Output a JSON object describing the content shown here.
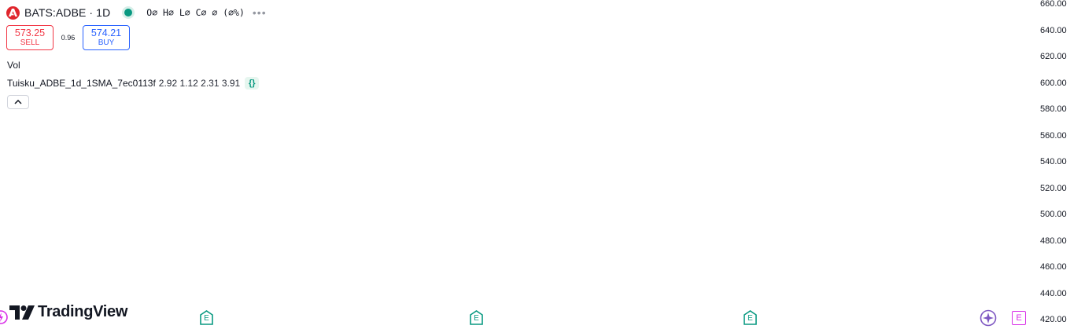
{
  "symbol": {
    "title": "BATS:ADBE · 1D",
    "logo_icon": "adobe-logo-icon",
    "ohlc": "O∅ H∅ L∅ C∅ ∅ (∅%)"
  },
  "trade": {
    "sell_price": "573.25",
    "sell_label": "SELL",
    "spread": "0.96",
    "buy_price": "574.21",
    "buy_label": "BUY"
  },
  "legend": {
    "volume_label": "Vol",
    "indicator_name": "Tuisku_ADBE_1d_1SMA_7ec0113f",
    "indicator_values": "2.92 1.12 2.31 3.91",
    "source_code_icon": "{}"
  },
  "price_scale": {
    "ticks": [
      "660.00",
      "640.00",
      "620.00",
      "600.00",
      "580.00",
      "560.00",
      "540.00",
      "520.00",
      "500.00",
      "480.00",
      "460.00",
      "440.00",
      "420.00"
    ]
  },
  "branding": {
    "name": "TradingView"
  },
  "events": {
    "earnings_label": "E"
  },
  "colors": {
    "sell": "#f23645",
    "buy": "#2962ff",
    "status": "#089981",
    "earnings": "#089981",
    "dividend": "#d930e8",
    "star": "#7e57c2"
  }
}
